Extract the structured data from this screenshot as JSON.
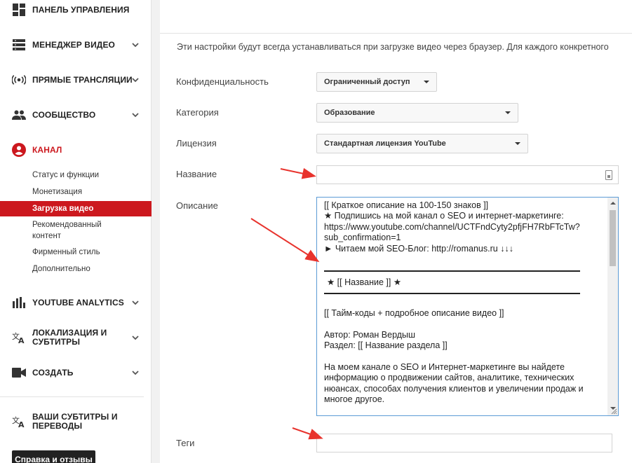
{
  "sidebar": {
    "items": [
      {
        "label": "ПАНЕЛЬ УПРАВЛЕНИЯ",
        "icon": "dashboard-icon"
      },
      {
        "label": "МЕНЕДЖЕР ВИДЕО",
        "icon": "video-manager-icon"
      },
      {
        "label": "ПРЯМЫЕ ТРАНСЛЯЦИИ",
        "icon": "live-broadcast-icon"
      },
      {
        "label": "СООБЩЕСТВО",
        "icon": "community-icon"
      },
      {
        "label": "КАНАЛ",
        "icon": "channel-icon"
      },
      {
        "label": "YOUTUBE ANALYTICS",
        "icon": "analytics-icon"
      },
      {
        "label": "ЛОКАЛИЗАЦИЯ И СУБТИТРЫ",
        "icon": "translate-icon"
      },
      {
        "label": "СОЗДАТЬ",
        "icon": "create-video-icon"
      },
      {
        "label": "ВАШИ СУБТИТРЫ И ПЕРЕВОДЫ",
        "icon": "subtitles-translate-icon"
      }
    ],
    "channel_sub": [
      "Статус и функции",
      "Монетизация",
      "Загрузка видео",
      "Рекомендованный контент",
      "Фирменный стиль",
      "Дополнительно"
    ],
    "help_button": "Справка и отзывы"
  },
  "main": {
    "intro": "Эти настройки будут всегда устанавливаться при загрузке видео через браузер. Для каждого конкретного",
    "privacy": {
      "label": "Конфиденциальность",
      "value": "Ограниченный доступ"
    },
    "category": {
      "label": "Категория",
      "value": "Образование"
    },
    "license": {
      "label": "Лицензия",
      "value": "Стандартная лицензия YouTube"
    },
    "title": {
      "label": "Название",
      "value": ""
    },
    "description": {
      "label": "Описание",
      "block1": "[[ Краткое описание на 100-150 знаков ]]\n★ Подпишись на мой канал о SEO и интернет-маркетинге:\nhttps://www.youtube.com/channel/UCTFndCyty2pfjFH7RbFTcTw?sub_confirmation=1\n► Читаем мой SEO-Блог: http://romanus.ru    ↓↓↓",
      "block2": "★ [[ Название ]] ★",
      "block3": "[[ Тайм-коды + подробное описание видео ]]\n\nАвтор: Роман Вердыш\nРаздел: [[ Название раздела ]]\n\nНа моем канале о SEO и Интернет-маркетинге вы найдете информацию о продвижении сайтов,  аналитике, технических нюансах, способах получения клиентов и увеличении продаж и многое другое."
    },
    "tags": {
      "label": "Теги",
      "value": ""
    }
  },
  "colors": {
    "accent": "#cc181e",
    "focus_border": "#5b9bd5",
    "annotation_arrow": "#e8332d"
  }
}
